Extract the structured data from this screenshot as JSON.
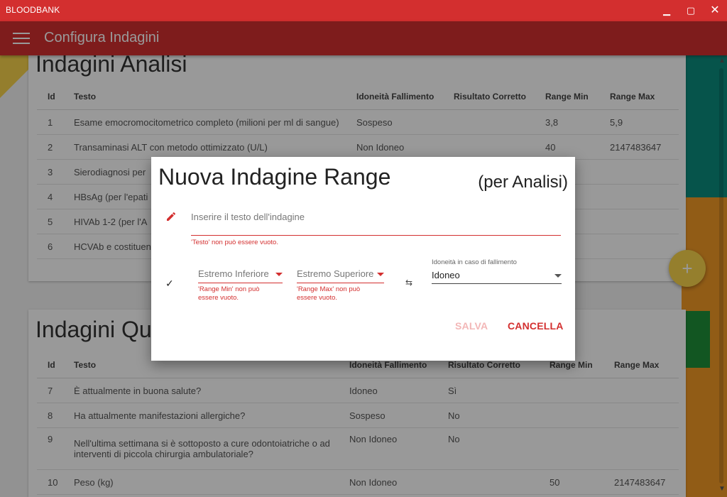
{
  "window": {
    "title": "BLOODBANK",
    "min_glyph": "▁",
    "max_glyph": "▢",
    "close_glyph": "✕"
  },
  "appbar": {
    "title": "Configura Indagini"
  },
  "analisi": {
    "title": "Indagini Analisi",
    "columns": [
      "Id",
      "Testo",
      "Idoneità Fallimento",
      "Risultato Corretto",
      "Range Min",
      "Range Max"
    ],
    "rows": [
      [
        "1",
        "Esame emocromocitometrico completo (milioni per ml di sangue)",
        "Sospeso",
        "",
        "3,8",
        "5,9"
      ],
      [
        "2",
        "Transaminasi ALT con metodo ottimizzato (U/L)",
        "Non Idoneo",
        "",
        "40",
        "2147483647"
      ],
      [
        "3",
        "Sierodiagnosi per",
        "",
        "",
        "",
        ""
      ],
      [
        "4",
        "HBsAg (per l'epati",
        "",
        "",
        "",
        ""
      ],
      [
        "5",
        "HIVAb 1-2 (per l'A",
        "",
        "",
        "",
        ""
      ],
      [
        "6",
        "HCVAb e costituen",
        "",
        "",
        "",
        ""
      ]
    ]
  },
  "questionario": {
    "title": "Indagini Qu",
    "columns": [
      "Id",
      "Testo",
      "Idoneità Fallimento",
      "Risultato Corretto",
      "Range Min",
      "Range Max"
    ],
    "rows": [
      [
        "7",
        "È attualmente in buona salute?",
        "Idoneo",
        "Sì",
        "",
        ""
      ],
      [
        "8",
        "Ha attualmente manifestazioni allergiche?",
        "Sospeso",
        "No",
        "",
        ""
      ],
      [
        "9",
        "Nell'ultima settimana si è sottoposto a cure odontoiatriche o ad interventi di piccola chirurgia ambulatoriale?",
        "Non Idoneo",
        "No",
        "",
        ""
      ],
      [
        "10",
        "Peso (kg)",
        "Non Idoneo",
        "",
        "50",
        "2147483647"
      ]
    ]
  },
  "fab": {
    "glyph": "+"
  },
  "dialog": {
    "title": "Nuova Indagine Range",
    "subtitle": "(per Analisi)",
    "text_placeholder": "Inserire il testo dell'indagine",
    "text_error": "'Testo' non può essere vuoto.",
    "min_placeholder": "Estremo Inferiore",
    "min_error": "'Range Min' non può essere vuoto.",
    "max_placeholder": "Estremo Superiore",
    "max_error": "'Range Max' non può essere vuoto.",
    "idoneita_label": "Idoneità in caso di fallimento",
    "idoneita_value": "Idoneo",
    "save_label": "SALVA",
    "cancel_label": "CANCELLA",
    "check_glyph": "✓",
    "swap_glyph": "⇆"
  },
  "colors": {
    "accent": "#d32f2f",
    "fab": "#f8d44c"
  }
}
